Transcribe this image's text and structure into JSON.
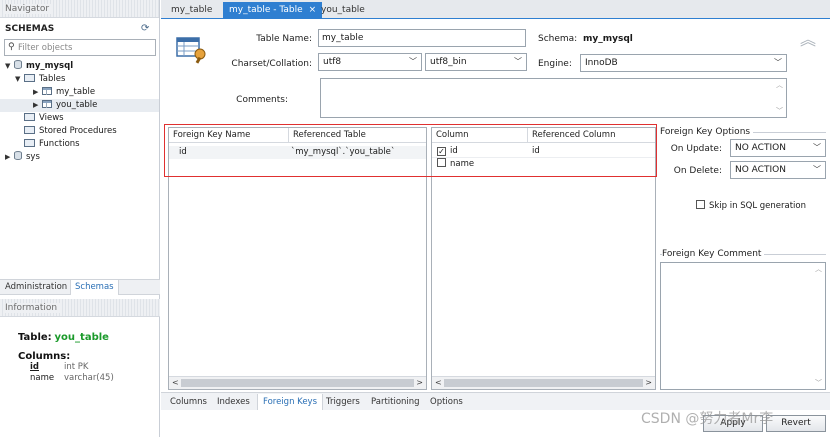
{
  "navigator": {
    "title": "Navigator",
    "schemas_title": "SCHEMAS",
    "filter_placeholder": "Filter objects",
    "tree": {
      "schema": "my_mysql",
      "tables_folder": "Tables",
      "tables": [
        "my_table",
        "you_table"
      ],
      "views": "Views",
      "procedures": "Stored Procedures",
      "functions": "Functions",
      "other_schema": "sys"
    },
    "tabs": [
      "Administration",
      "Schemas"
    ],
    "info_title": "Information",
    "info": {
      "table_label": "Table:",
      "table_name": "you_table",
      "columns_label": "Columns:",
      "columns": [
        {
          "name": "id",
          "type": "int PK"
        },
        {
          "name": "name",
          "type": "varchar(45)"
        }
      ]
    }
  },
  "tabs": [
    {
      "label": "my_table"
    },
    {
      "label": "my_table - Table",
      "close": "×"
    },
    {
      "label": "you_table"
    }
  ],
  "editor": {
    "table_name_label": "Table Name:",
    "table_name": "my_table",
    "schema_label": "Schema:",
    "schema": "my_mysql",
    "charset_label": "Charset/Collation:",
    "charset": "utf8",
    "collation": "utf8_bin",
    "engine_label": "Engine:",
    "engine": "InnoDB",
    "comments_label": "Comments:"
  },
  "fk_grid": {
    "headers": [
      "Foreign Key Name",
      "Referenced Table"
    ],
    "rows": [
      {
        "name": "id",
        "ref_table": "`my_mysql`.`you_table`"
      }
    ]
  },
  "col_grid": {
    "headers": [
      "Column",
      "Referenced Column"
    ],
    "rows": [
      {
        "column": "id",
        "ref_column": "id",
        "checked": true
      },
      {
        "column": "name",
        "ref_column": "",
        "checked": false
      }
    ]
  },
  "options": {
    "title": "Foreign Key Options",
    "on_update_label": "On Update:",
    "on_update": "NO ACTION",
    "on_delete_label": "On Delete:",
    "on_delete": "NO ACTION",
    "skip_label": "Skip in SQL generation",
    "comment_title": "Foreign Key Comment"
  },
  "bottom_tabs": [
    "Columns",
    "Indexes",
    "Foreign Keys",
    "Triggers",
    "Partitioning",
    "Options"
  ],
  "buttons": {
    "apply": "Apply",
    "revert": "Revert"
  },
  "watermark": "CSDN @努力者Mr李",
  "colors": {
    "accent": "#2f7fd1",
    "highlight": "#e03030",
    "info_green": "#1a9a2a"
  }
}
